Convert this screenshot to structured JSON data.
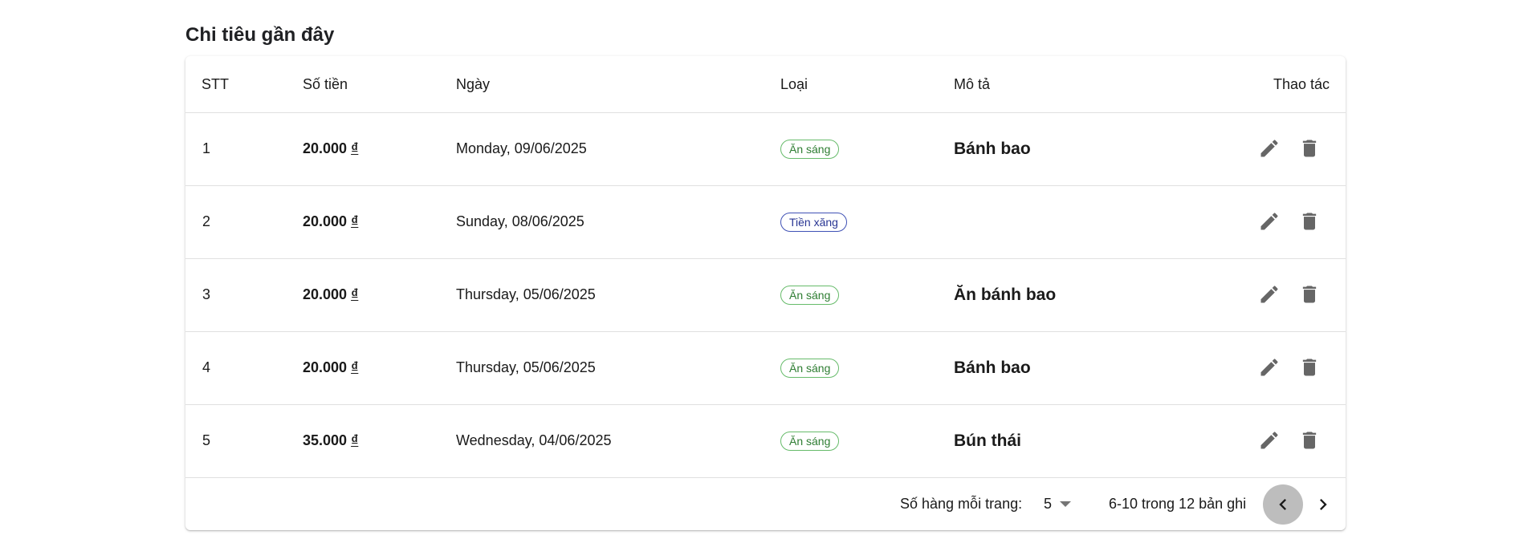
{
  "section": {
    "title": "Chi tiêu gần đây"
  },
  "table": {
    "headers": {
      "stt": "STT",
      "amount": "Số tiền",
      "date": "Ngày",
      "category": "Loại",
      "description": "Mô tả",
      "actions": "Thao tác"
    },
    "rows": [
      {
        "stt": "1",
        "amount": "20.000",
        "currency": "₫",
        "date": "Monday, 09/06/2025",
        "category": "Ăn sáng",
        "description": "Bánh bao"
      },
      {
        "stt": "2",
        "amount": "20.000",
        "currency": "₫",
        "date": "Sunday, 08/06/2025",
        "category": "Tiền xăng",
        "description": ""
      },
      {
        "stt": "3",
        "amount": "20.000",
        "currency": "₫",
        "date": "Thursday, 05/06/2025",
        "category": "Ăn sáng",
        "description": "Ăn bánh bao"
      },
      {
        "stt": "4",
        "amount": "20.000",
        "currency": "₫",
        "date": "Thursday, 05/06/2025",
        "category": "Ăn sáng",
        "description": "Bánh bao"
      },
      {
        "stt": "5",
        "amount": "35.000",
        "currency": "₫",
        "date": "Wednesday, 04/06/2025",
        "category": "Ăn sáng",
        "description": "Bún thái"
      }
    ],
    "action_icons": {
      "edit": "edit-icon",
      "delete": "trash-icon"
    }
  },
  "pagination": {
    "rows_per_page_label": "Số hàng mỗi trang:",
    "rows_per_page_value": "5",
    "range_text": "6-10 trong 12 bản ghi",
    "prev_icon": "chevron-left-icon",
    "next_icon": "chevron-right-icon"
  },
  "colors": {
    "chip_breakfast_text": "#2e7d32",
    "chip_breakfast_border": "#66bb6a",
    "chip_fuel_text": "#283593",
    "chip_fuel_border": "#3f51b5",
    "icon_gray": "#666666",
    "prev_button_bg": "#bdbdbd"
  }
}
